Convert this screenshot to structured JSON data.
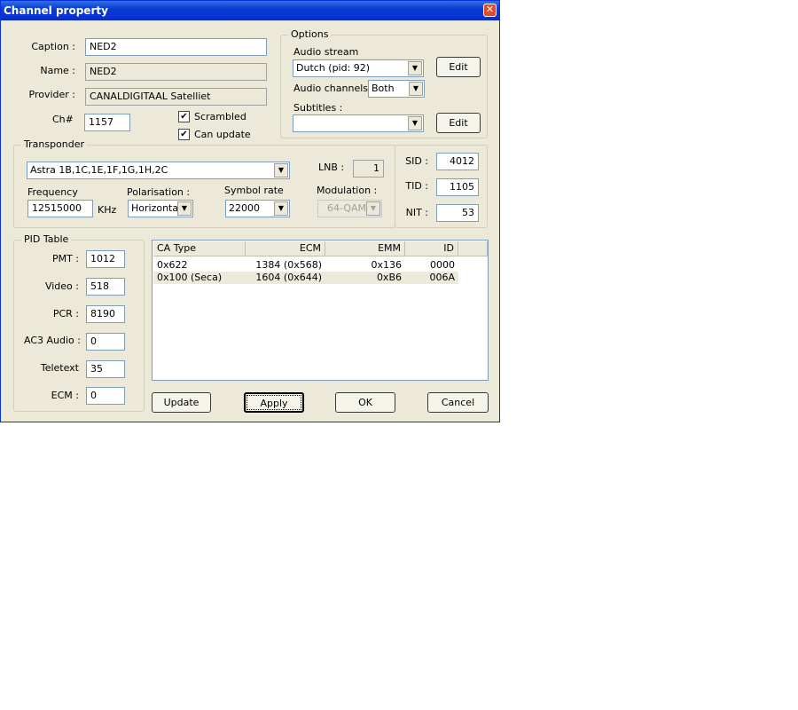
{
  "window": {
    "title": "Channel property"
  },
  "general": {
    "caption_label": "Caption :",
    "caption_value": "NED2",
    "name_label": "Name :",
    "name_value": "NED2",
    "provider_label": "Provider :",
    "provider_value": "CANALDIGITAAL Satelliet",
    "ch_label": "Ch#",
    "ch_value": "1157",
    "scrambled_label": "Scrambled",
    "scrambled_checked": true,
    "canupdate_label": "Can update",
    "canupdate_checked": true
  },
  "options": {
    "group_label": "Options",
    "audio_stream_label": "Audio stream",
    "audio_stream_value": "Dutch  (pid: 92)",
    "edit1_label": "Edit",
    "audio_channels_label": "Audio channels :",
    "audio_channels_value": "Both",
    "subtitles_label": "Subtitles :",
    "subtitles_value": "",
    "edit2_label": "Edit"
  },
  "transponder": {
    "group_label": "Transponder",
    "satellite_value": "Astra 1B,1C,1E,1F,1G,1H,2C",
    "lnb_label": "LNB :",
    "lnb_value": "1",
    "frequency_label": "Frequency",
    "frequency_value": "12515000",
    "frequency_unit": "KHz",
    "polarisation_label": "Polarisation :",
    "polarisation_value": "Horizontal",
    "symbolrate_label": "Symbol rate",
    "symbolrate_value": "22000",
    "modulation_label": "Modulation :",
    "modulation_value": "64-QAM",
    "sid_label": "SID :",
    "sid_value": "4012",
    "tid_label": "TID :",
    "tid_value": "1105",
    "nit_label": "NIT :",
    "nit_value": "53"
  },
  "pid_table": {
    "group_label": "PID Table",
    "pmt_label": "PMT :",
    "pmt_value": "1012",
    "video_label": "Video :",
    "video_value": "518",
    "pcr_label": "PCR :",
    "pcr_value": "8190",
    "ac3_label": "AC3 Audio :",
    "ac3_value": "0",
    "teletext_label": "Teletext",
    "teletext_value": "35",
    "ecm_label": "ECM :",
    "ecm_value": "0"
  },
  "ca_list": {
    "headers": [
      "CA Type",
      "ECM",
      "EMM",
      "ID"
    ],
    "rows": [
      [
        "0x622",
        "1384 (0x568)",
        "0x136",
        "0000"
      ],
      [
        "0x100 (Seca)",
        "1604 (0x644)",
        "0xB6",
        "006A"
      ]
    ]
  },
  "buttons": {
    "update": "Update",
    "apply": "Apply",
    "ok": "OK",
    "cancel": "Cancel"
  }
}
